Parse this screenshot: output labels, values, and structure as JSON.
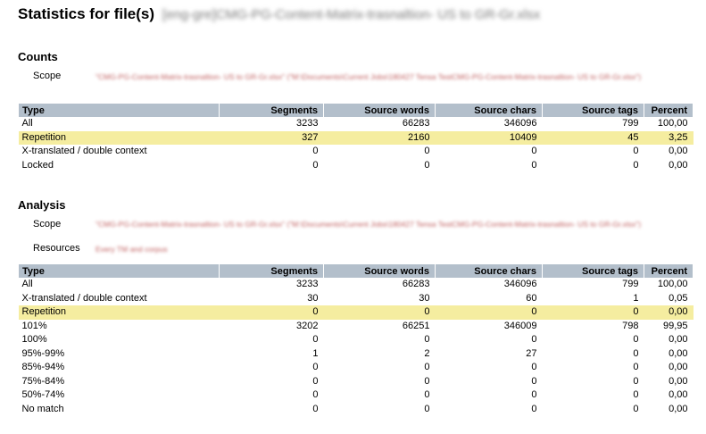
{
  "title": {
    "label": "Statistics for file(s)",
    "file": "[eng-gre]CMG-PG-Content-Matrix-trasnaltion- US to GR-Gr.xlsx"
  },
  "counts": {
    "heading": "Counts",
    "scope_label": "Scope",
    "scope_value": "\"CMG-PG-Content-Matrix-trasnaltion- US to GR-Gr.xlsx\" (\"M:\\Documents\\Current Jobs\\180427 Tensa TestCMG-PG-Content-Matrix-trasnaltion- US to GR-Gr.xlsx\")",
    "columns": [
      "Type",
      "Segments",
      "Source words",
      "Source chars",
      "Source tags",
      "Percent"
    ],
    "rows": [
      {
        "cells": [
          "All",
          "3233",
          "66283",
          "346096",
          "799",
          "100,00"
        ],
        "highlight": false
      },
      {
        "cells": [
          "Repetition",
          "327",
          "2160",
          "10409",
          "45",
          "3,25"
        ],
        "highlight": true
      },
      {
        "cells": [
          "X-translated / double context",
          "0",
          "0",
          "0",
          "0",
          "0,00"
        ],
        "highlight": false
      },
      {
        "cells": [
          "Locked",
          "0",
          "0",
          "0",
          "0",
          "0,00"
        ],
        "highlight": false
      }
    ]
  },
  "analysis": {
    "heading": "Analysis",
    "scope_label": "Scope",
    "scope_value": "\"CMG-PG-Content-Matrix-trasnaltion- US to GR-Gr.xlsx\" (\"M:\\Documents\\Current Jobs\\180427 Tensa TestCMG-PG-Content-Matrix-trasnaltion- US to GR-Gr.xlsx\")",
    "resources_label": "Resources",
    "resources_value": "Every TM and corpus",
    "columns": [
      "Type",
      "Segments",
      "Source words",
      "Source chars",
      "Source tags",
      "Percent"
    ],
    "rows": [
      {
        "cells": [
          "All",
          "3233",
          "66283",
          "346096",
          "799",
          "100,00"
        ],
        "highlight": false
      },
      {
        "cells": [
          "X-translated / double context",
          "30",
          "30",
          "60",
          "1",
          "0,05"
        ],
        "highlight": false
      },
      {
        "cells": [
          "Repetition",
          "0",
          "0",
          "0",
          "0",
          "0,00"
        ],
        "highlight": true
      },
      {
        "cells": [
          "101%",
          "3202",
          "66251",
          "346009",
          "798",
          "99,95"
        ],
        "highlight": false
      },
      {
        "cells": [
          "100%",
          "0",
          "0",
          "0",
          "0",
          "0,00"
        ],
        "highlight": false
      },
      {
        "cells": [
          "95%-99%",
          "1",
          "2",
          "27",
          "0",
          "0,00"
        ],
        "highlight": false
      },
      {
        "cells": [
          "85%-94%",
          "0",
          "0",
          "0",
          "0",
          "0,00"
        ],
        "highlight": false
      },
      {
        "cells": [
          "75%-84%",
          "0",
          "0",
          "0",
          "0",
          "0,00"
        ],
        "highlight": false
      },
      {
        "cells": [
          "50%-74%",
          "0",
          "0",
          "0",
          "0",
          "0,00"
        ],
        "highlight": false
      },
      {
        "cells": [
          "No match",
          "0",
          "0",
          "0",
          "0",
          "0,00"
        ],
        "highlight": false
      }
    ]
  },
  "colors": {
    "header_bg": "#b3bfcb",
    "highlight_bg": "#f5eda0",
    "blurred_text": "#c06060"
  }
}
